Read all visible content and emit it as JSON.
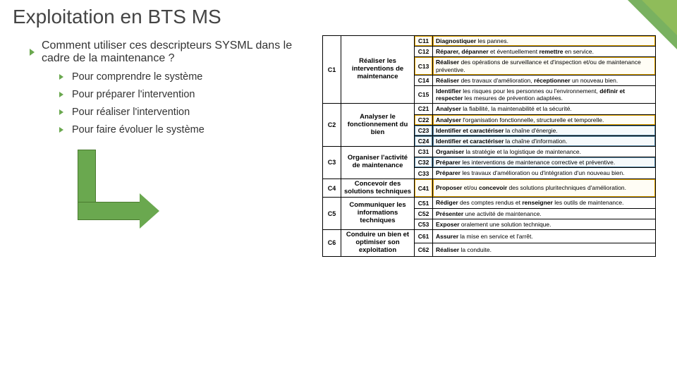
{
  "title": "Exploitation en BTS MS",
  "question": "Comment utiliser ces descripteurs SYSML dans le cadre de la maintenance ?",
  "bullets": [
    "Pour comprendre le système",
    "Pour préparer l'intervention",
    "Pour réaliser l'intervention",
    "Pour faire évoluer le système"
  ],
  "groups": [
    {
      "code": "C1",
      "label": "Réaliser les interventions de maintenance",
      "rows": [
        {
          "c": "C11",
          "t": "<b>Diagnostiquer</b> les pannes.",
          "cls": "hlY"
        },
        {
          "c": "C12",
          "t": "<b>Réparer, dépanner</b> et éventuellement <b>remettre</b> en service.",
          "cls": ""
        },
        {
          "c": "C13",
          "t": "<b>Réaliser</b> des opérations de surveillance et d'inspection et/ou de maintenance préventive.",
          "cls": "hlY"
        },
        {
          "c": "C14",
          "t": "<b>Réaliser</b> des travaux d'amélioration, <b>réceptionner</b> un nouveau bien.",
          "cls": ""
        },
        {
          "c": "C15",
          "t": "<b>Identifier</b> les risques pour les personnes ou l'environnement, <b>définir et respecter</b> les mesures de prévention adaptées.",
          "cls": ""
        }
      ]
    },
    {
      "code": "C2",
      "label": "Analyser le fonctionnement du bien",
      "rows": [
        {
          "c": "C21",
          "t": "<b>Analyser</b> la fiabilité, la maintenabilité et la sécurité.",
          "cls": ""
        },
        {
          "c": "C22",
          "t": "<b>Analyser</b> l'organisation fonctionnelle, structurelle et temporelle.",
          "cls": "hlY"
        },
        {
          "c": "C23",
          "t": "<b>Identifier et caractériser</b> la chaîne d'énergie.",
          "cls": "hlB"
        },
        {
          "c": "C24",
          "t": "<b>Identifier et caractériser</b> la chaîne d'information.",
          "cls": "hlB"
        }
      ]
    },
    {
      "code": "C3",
      "label": "Organiser l'activité de maintenance",
      "rows": [
        {
          "c": "C31",
          "t": "<b>Organiser</b> la stratégie et la logistique de maintenance.",
          "cls": ""
        },
        {
          "c": "C32",
          "t": "<b>Préparer</b> les interventions de maintenance corrective et préventive.",
          "cls": "hlB"
        },
        {
          "c": "C33",
          "t": "<b>Préparer</b> les travaux d'amélioration ou d'intégration d'un nouveau bien.",
          "cls": ""
        }
      ]
    },
    {
      "code": "C4",
      "label": "Concevoir des solutions techniques",
      "rows": [
        {
          "c": "C41",
          "t": "<b>Proposer</b> et/ou <b>concevoir</b> des solutions pluritechniques d'amélioration.",
          "cls": "hlY"
        }
      ]
    },
    {
      "code": "C5",
      "label": "Communiquer les informations techniques",
      "rows": [
        {
          "c": "C51",
          "t": "<b>Rédiger</b> des comptes rendus et <b>renseigner</b> les outils de maintenance.",
          "cls": ""
        },
        {
          "c": "C52",
          "t": "<b>Présenter</b> une activité de maintenance.",
          "cls": ""
        },
        {
          "c": "C53",
          "t": "<b>Exposer</b> oralement une solution technique.",
          "cls": ""
        }
      ]
    },
    {
      "code": "C6",
      "label": "Conduire un bien et optimiser son exploitation",
      "rows": [
        {
          "c": "C61",
          "t": "<b>Assurer</b> la mise en service et l'arrêt.",
          "cls": ""
        },
        {
          "c": "C62",
          "t": "<b>Réaliser</b> la conduite.",
          "cls": ""
        }
      ]
    }
  ]
}
